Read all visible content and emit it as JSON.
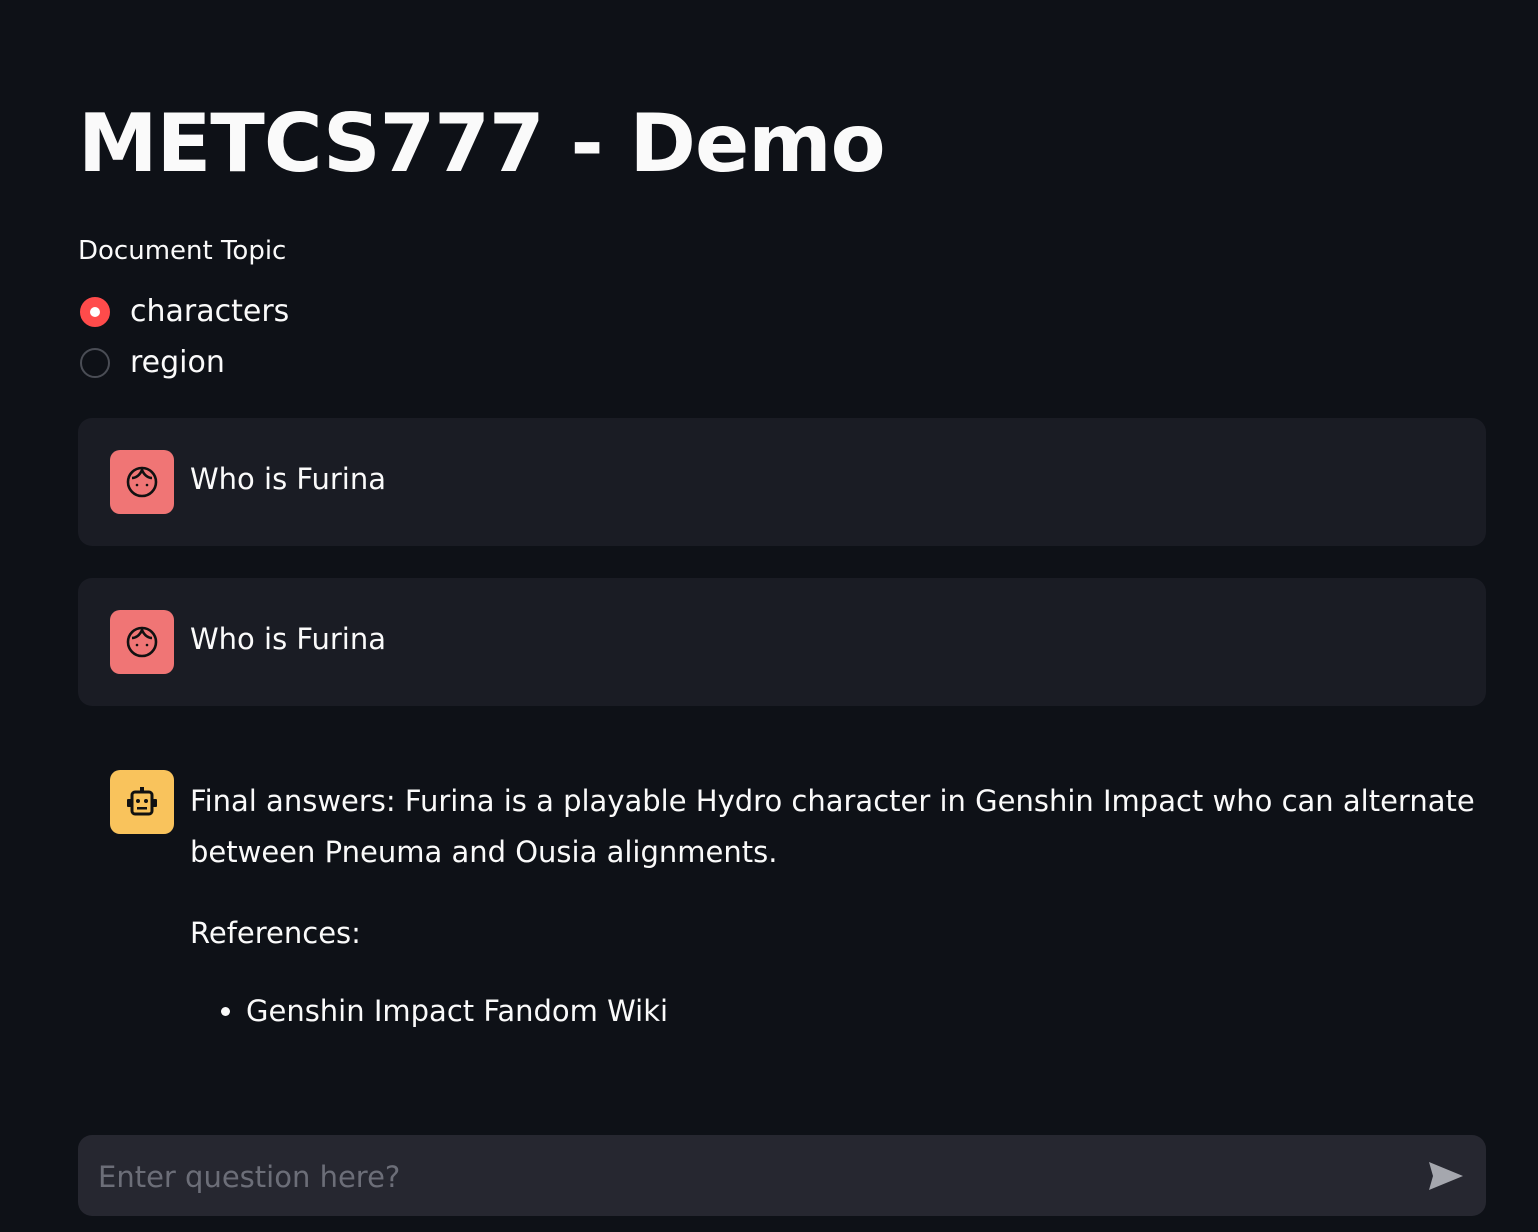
{
  "header": {
    "title": "METCS777 - Demo"
  },
  "topic_selector": {
    "label": "Document Topic",
    "options": [
      {
        "label": "characters",
        "selected": true
      },
      {
        "label": "region",
        "selected": false
      }
    ],
    "accent_color": "#ff4b4b"
  },
  "chat": {
    "messages": [
      {
        "role": "user",
        "avatar_icon": "user-face-icon",
        "text": "Who is Furina"
      },
      {
        "role": "user",
        "avatar_icon": "user-face-icon",
        "text": "Who is Furina"
      },
      {
        "role": "assistant",
        "avatar_icon": "robot-icon",
        "answer": "Final answers: Furina is a playable Hydro character in Genshin Impact who can alternate between Pneuma and Ousia alignments.",
        "references_heading": "References:",
        "references": [
          "Genshin Impact Fandom Wiki"
        ]
      }
    ],
    "user_avatar_color": "#f07575",
    "assistant_avatar_color": "#f9c35c"
  },
  "input": {
    "placeholder": "Enter question here?",
    "value": "",
    "send_icon": "send-icon"
  }
}
